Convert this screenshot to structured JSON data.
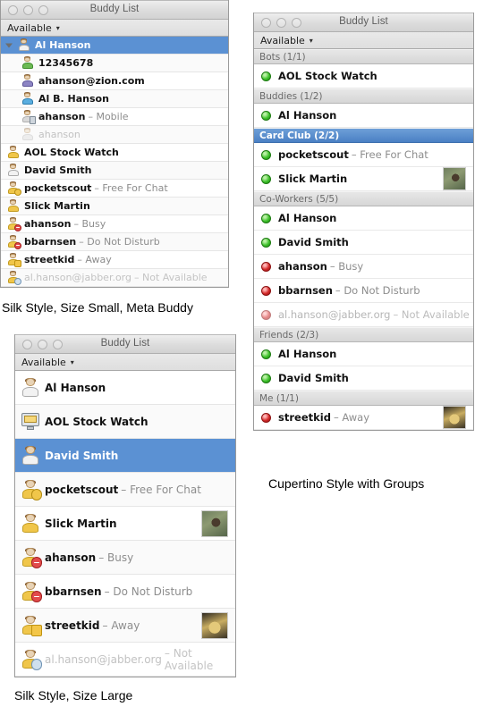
{
  "captions": {
    "silk_small": "Silk Style, Size Small, Meta Buddy",
    "cupertino": "Cupertino Style with Groups",
    "silk_large": "Silk Style, Size Large"
  },
  "colors": {
    "selection_blue": "#5b91d3",
    "group_header_selected": "#4a80c4",
    "online_green": "#3fc22c",
    "offline_red": "#d42a2a",
    "status_text_gray": "#8d8d8d"
  },
  "window_silk_small": {
    "title": "Buddy List",
    "status": {
      "label": "Available",
      "caret": "▾"
    },
    "traffic_lights": [
      "close-button",
      "minimize-button",
      "zoom-button"
    ],
    "rows": [
      {
        "name": "Al Hanson",
        "status": "",
        "icon": "buddy-plain",
        "selected": true,
        "expanded": true,
        "child": false,
        "avatar": ""
      },
      {
        "name": "12345678",
        "status": "",
        "icon": "buddy-green",
        "selected": false,
        "expanded": false,
        "child": true,
        "avatar": ""
      },
      {
        "name": "ahanson@zion.com",
        "status": "",
        "icon": "buddy-purple",
        "selected": false,
        "expanded": false,
        "child": true,
        "avatar": ""
      },
      {
        "name": "Al B. Hanson",
        "status": "",
        "icon": "buddy-blue",
        "selected": false,
        "expanded": false,
        "child": true,
        "avatar": ""
      },
      {
        "name": "ahanson",
        "status": "– Mobile",
        "icon": "buddy-mobile",
        "selected": false,
        "expanded": false,
        "child": true,
        "avatar": ""
      },
      {
        "name": "ahanson",
        "status": "",
        "icon": "buddy-offline",
        "selected": false,
        "expanded": false,
        "child": true,
        "avatar": "",
        "offline": true
      },
      {
        "name": "AOL Stock Watch",
        "status": "",
        "icon": "buddy-gold",
        "selected": false,
        "expanded": false,
        "child": false,
        "avatar": ""
      },
      {
        "name": "David Smith",
        "status": "",
        "icon": "buddy-plain",
        "selected": false,
        "expanded": false,
        "child": false,
        "avatar": ""
      },
      {
        "name": "pocketscout",
        "status": "– Free For Chat",
        "icon": "buddy-coins",
        "selected": false,
        "expanded": false,
        "child": false,
        "avatar": ""
      },
      {
        "name": "Slick Martin",
        "status": "",
        "icon": "buddy-gold",
        "selected": false,
        "expanded": false,
        "child": false,
        "avatar": ""
      },
      {
        "name": "ahanson",
        "status": "– Busy",
        "icon": "buddy-busy",
        "selected": false,
        "expanded": false,
        "child": false,
        "avatar": ""
      },
      {
        "name": "bbarnsen",
        "status": "– Do Not Disturb",
        "icon": "buddy-busy",
        "selected": false,
        "expanded": false,
        "child": false,
        "avatar": ""
      },
      {
        "name": "streetkid",
        "status": "– Away",
        "icon": "buddy-away",
        "selected": false,
        "expanded": false,
        "child": false,
        "avatar": ""
      },
      {
        "name": "al.hanson@jabber.org",
        "status": "– Not Available",
        "icon": "buddy-clock",
        "selected": false,
        "expanded": false,
        "child": false,
        "avatar": "",
        "offline": true
      }
    ]
  },
  "window_cupertino": {
    "title": "Buddy List",
    "status": {
      "label": "Available",
      "caret": "▾"
    },
    "traffic_lights": [
      "close-button",
      "minimize-button",
      "zoom-button"
    ],
    "groups": [
      {
        "label": "Bots (1/1)",
        "selected": false,
        "rows": [
          {
            "name": "AOL Stock Watch",
            "status": "",
            "presence": "online",
            "avatar": ""
          }
        ]
      },
      {
        "label": "Buddies (1/2)",
        "selected": false,
        "rows": [
          {
            "name": "Al Hanson",
            "status": "",
            "presence": "online",
            "avatar": ""
          }
        ]
      },
      {
        "label": "Card Club (2/2)",
        "selected": true,
        "rows": [
          {
            "name": "pocketscout",
            "status": "– Free For Chat",
            "presence": "online",
            "avatar": ""
          },
          {
            "name": "Slick Martin",
            "status": "",
            "presence": "online",
            "avatar": "fish"
          }
        ]
      },
      {
        "label": "Co-Workers (5/5)",
        "selected": false,
        "rows": [
          {
            "name": "Al Hanson",
            "status": "",
            "presence": "online",
            "avatar": ""
          },
          {
            "name": "David Smith",
            "status": "",
            "presence": "online",
            "avatar": ""
          },
          {
            "name": "ahanson",
            "status": "– Busy",
            "presence": "offline",
            "avatar": ""
          },
          {
            "name": "bbarnsen",
            "status": "– Do Not Disturb",
            "presence": "offline",
            "avatar": ""
          },
          {
            "name": "al.hanson@jabber.org",
            "status": "– Not Available",
            "presence": "offline",
            "avatar": "",
            "dim": true
          }
        ]
      },
      {
        "label": "Friends (2/3)",
        "selected": false,
        "rows": [
          {
            "name": "Al Hanson",
            "status": "",
            "presence": "online",
            "avatar": ""
          },
          {
            "name": "David Smith",
            "status": "",
            "presence": "online",
            "avatar": ""
          }
        ]
      },
      {
        "label": "Me (1/1)",
        "selected": false,
        "rows": [
          {
            "name": "streetkid",
            "status": "– Away",
            "presence": "offline",
            "avatar": "car"
          }
        ]
      }
    ]
  },
  "window_silk_large": {
    "title": "Buddy List",
    "status": {
      "label": "Available",
      "caret": "▾"
    },
    "traffic_lights": [
      "close-button",
      "minimize-button",
      "zoom-button"
    ],
    "rows": [
      {
        "name": "Al Hanson",
        "status": "",
        "icon": "buddy-plain",
        "selected": false,
        "avatar": ""
      },
      {
        "name": "AOL Stock Watch",
        "status": "",
        "icon": "buddy-monitor",
        "selected": false,
        "avatar": ""
      },
      {
        "name": "David Smith",
        "status": "",
        "icon": "buddy-plain",
        "selected": true,
        "avatar": ""
      },
      {
        "name": "pocketscout",
        "status": "– Free For Chat",
        "icon": "buddy-coins",
        "selected": false,
        "avatar": ""
      },
      {
        "name": "Slick Martin",
        "status": "",
        "icon": "buddy-gold",
        "selected": false,
        "avatar": "fish"
      },
      {
        "name": "ahanson",
        "status": "– Busy",
        "icon": "buddy-busy",
        "selected": false,
        "avatar": ""
      },
      {
        "name": "bbarnsen",
        "status": "– Do Not Disturb",
        "icon": "buddy-busy",
        "selected": false,
        "avatar": ""
      },
      {
        "name": "streetkid",
        "status": "– Away",
        "icon": "buddy-away",
        "selected": false,
        "avatar": "car"
      },
      {
        "name": "al.hanson@jabber.org",
        "status": "– Not Available",
        "icon": "buddy-clock",
        "selected": false,
        "avatar": "",
        "offline": true
      }
    ]
  }
}
